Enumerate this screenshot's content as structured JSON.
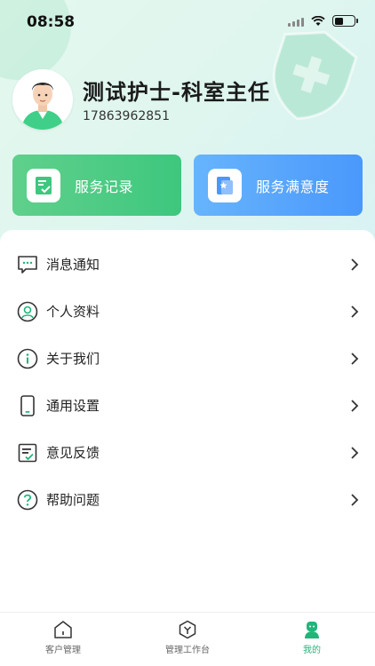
{
  "status_bar": {
    "time": "08:58"
  },
  "profile": {
    "name": "测试护士-科室主任",
    "phone": "17863962851"
  },
  "cards": [
    {
      "label": "服务记录",
      "icon": "service-record-icon",
      "color": "#3ec77e"
    },
    {
      "label": "服务满意度",
      "icon": "satisfaction-icon",
      "color": "#4a98fb"
    }
  ],
  "menu": {
    "items": [
      {
        "label": "消息通知",
        "icon": "message-icon"
      },
      {
        "label": "个人资料",
        "icon": "profile-icon"
      },
      {
        "label": "关于我们",
        "icon": "info-icon"
      },
      {
        "label": "通用设置",
        "icon": "phone-settings-icon"
      },
      {
        "label": "意见反馈",
        "icon": "feedback-icon"
      },
      {
        "label": "帮助问题",
        "icon": "help-icon"
      }
    ]
  },
  "tab_bar": {
    "tabs": [
      {
        "label": "客户管理",
        "icon": "home-icon",
        "active": false
      },
      {
        "label": "管理工作台",
        "icon": "workbench-icon",
        "active": false
      },
      {
        "label": "我的",
        "icon": "mine-icon",
        "active": true
      }
    ],
    "active_color": "#21b57a"
  }
}
